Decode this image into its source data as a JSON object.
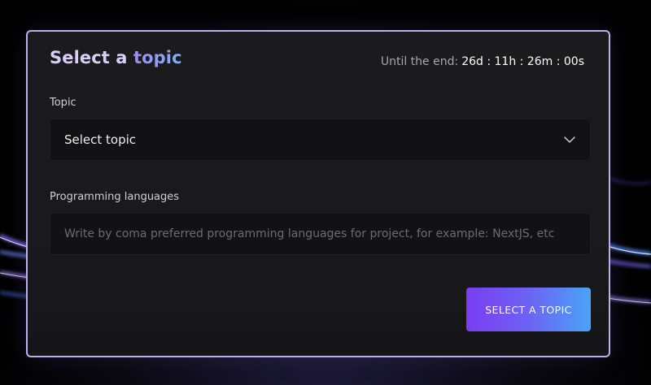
{
  "card": {
    "title_part1": "Select a ",
    "title_part2": "topic",
    "timer_label": "Until the end:",
    "timer_value": "26d : 11h : 26m : 00s"
  },
  "topic_field": {
    "label": "Topic",
    "selected_value": "Select topic",
    "icon": "chevron-down-icon"
  },
  "languages_field": {
    "label": "Programming languages",
    "value": "",
    "placeholder": "Write by coma preferred programming languages for project, for example: NextJS, etc"
  },
  "submit_button": {
    "label": "SELECT A TOPIC"
  },
  "colors": {
    "card_border": "#b9b3ea",
    "accent_start": "#7b3df2",
    "accent_end": "#4aa3f7",
    "title_color": "#d8cff7"
  }
}
